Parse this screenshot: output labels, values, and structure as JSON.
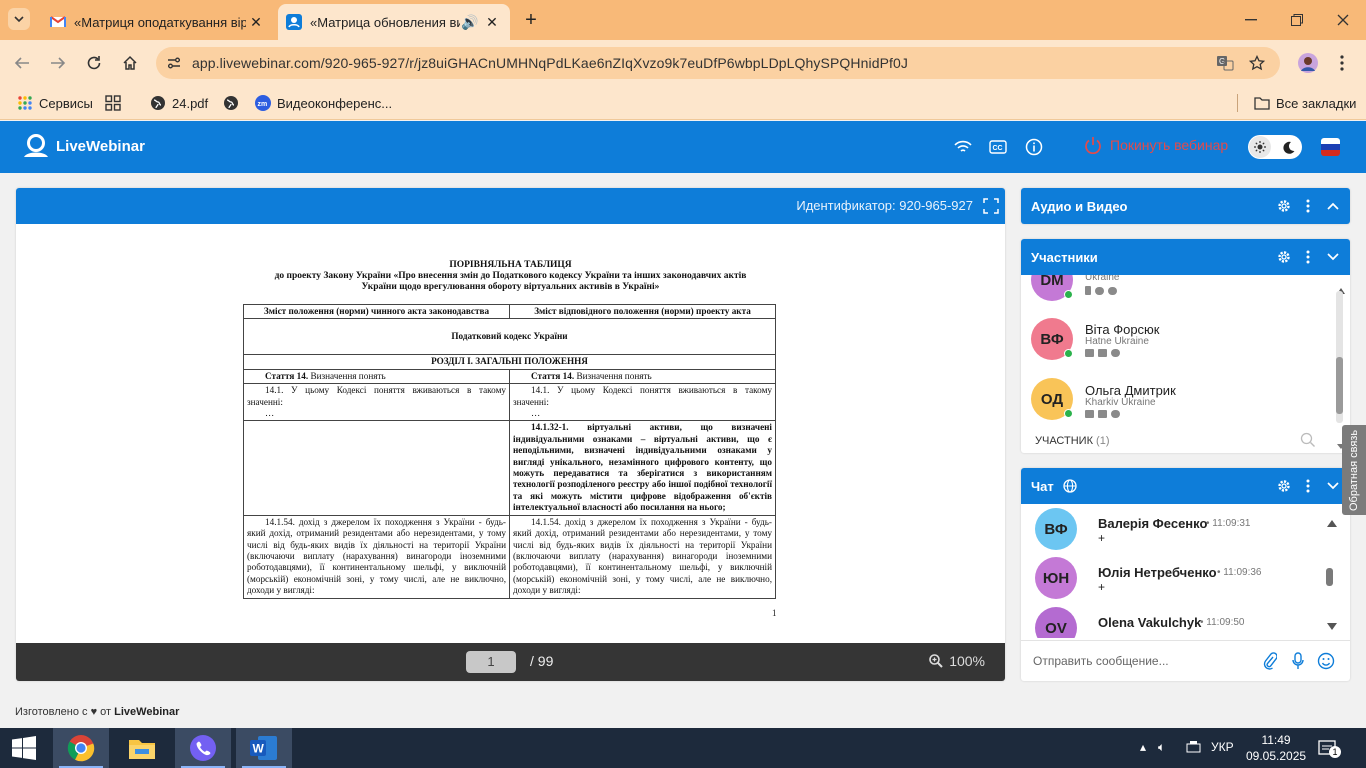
{
  "browser": {
    "tabs": [
      {
        "title": "«Матриця оподаткування вір",
        "favicon": "gmail-icon",
        "active": false
      },
      {
        "title": "«Матрица обновления вир",
        "favicon": "livewebinar-icon",
        "active": true
      }
    ],
    "url": "app.livewebinar.com/920-965-927/r/jz8uiGHACnUMHNqPdLKae6nZIqXvzo9k7euDfP6wbpLDpLQhySPQHnidPf0J",
    "bookmarks": [
      {
        "label": "Сервисы",
        "icon": "apps-grid-icon"
      },
      {
        "label": "",
        "icon": "grid-icon"
      },
      {
        "label": "24.pdf",
        "icon": "globe-icon"
      },
      {
        "label": "",
        "icon": "globe-icon"
      },
      {
        "label": "Видеоконференс...",
        "icon": "zoom-icon"
      }
    ],
    "all_bookmarks": "Все закладки"
  },
  "app": {
    "brand": "LiveWebinar",
    "leave_label": "Покинуть вебинар",
    "accent_color": "#0e7dd9",
    "leave_color": "#e24b4b"
  },
  "presentation": {
    "identifier": "Идентификатор: 920-965-927",
    "current_page": "1",
    "total_pages": "/ 99",
    "zoom": "100%",
    "document": {
      "title1": "ПОРІВНЯЛЬНА ТАБЛИЦЯ",
      "title2": "до проекту Закону України «Про внесення змін до Податкового кодексу України та інших законодавчих актів",
      "title3": "України щодо врегулювання обороту віртуальних активів в Україні»",
      "col1_header": "Зміст положення (норми) чинного акта законодавства",
      "col2_header": "Зміст відповідного положення (норми) проекту акта",
      "code_title": "Податковий кодекс України",
      "section_title": "РОЗДІЛ І. ЗАГАЛЬНІ ПОЛОЖЕННЯ",
      "article_label": "Стаття 14.",
      "article_name": " Визначення понять",
      "p1411": "14.1. У цьому Кодексі поняття вживаються в такому значенні:",
      "ellipsis": "…",
      "p14132": "14.1.32-1. віртуальні активи, що визначені індивідуальними ознаками – віртуальні активи, що є неподільними, визначені індивідуальними ознаками у вигляді унікального, незамінного цифрового контенту, що можуть передаватися та зберігатися з використанням технології розподіленого реєстру або іншої подібної технології та які можуть містити цифрове відображення об'єктів інтелектуальної власності або посилання на нього;",
      "p14154": "14.1.54. дохід з джерелом їх походження з України - будь-який дохід, отриманий резидентами або нерезидентами, у тому числі від будь-яких видів їх діяльності на території України (включаючи виплату (нарахування) винагороди іноземними роботодавцями), її континентальному шельфі, у виключній (морській) економічній зоні, у тому числі, але не виключно, доходи у вигляді:",
      "page_number": "1"
    }
  },
  "made_by": {
    "prefix": "Изготовлено с",
    "middle": "от",
    "brand": "LiveWebinar"
  },
  "audio_video": {
    "title": "Аудио и Видео"
  },
  "participants": {
    "title": "Участники",
    "list": [
      {
        "initials": "DM",
        "name": "",
        "location": "Ukraine",
        "color": "#c479d6"
      },
      {
        "initials": "ВФ",
        "name": "Віта Форсюк",
        "location": "Hatne Ukraine",
        "color": "#f07a8e"
      },
      {
        "initials": "ОД",
        "name": "Ольга Дмитрик",
        "location": "Kharkiv Ukraine",
        "color": "#f9c458"
      }
    ],
    "footer_label": "УЧАСТНИК",
    "footer_count": "(1)"
  },
  "chat": {
    "title": "Чат",
    "messages": [
      {
        "initials": "ВФ",
        "name": "Валерія Фесенко",
        "time": "11:09:31",
        "text": "+",
        "color": "#6cc6f2"
      },
      {
        "initials": "ЮН",
        "name": "Юлія Нетребченко",
        "time": "11:09:36",
        "text": "+",
        "color": "#c479d6"
      },
      {
        "initials": "OV",
        "name": "Olena Vakulchyk",
        "time": "11:09:50",
        "text": "",
        "color": "#b46bd1"
      }
    ],
    "input_placeholder": "Отправить сообщение..."
  },
  "feedback_label": "Обратная связь",
  "taskbar": {
    "language": "УКР",
    "time": "11:49",
    "date": "09.05.2025",
    "notification_count": "1"
  }
}
